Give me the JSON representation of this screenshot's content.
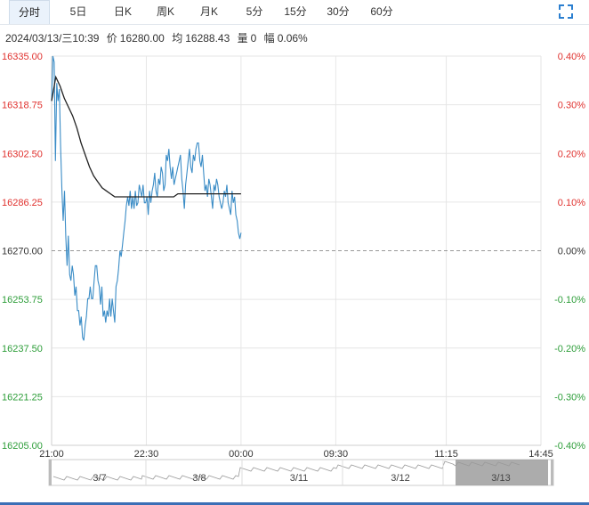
{
  "tabs": [
    {
      "label": "分时",
      "active": true
    },
    {
      "label": "5日",
      "active": false
    },
    {
      "label": "日K",
      "active": false
    },
    {
      "label": "周K",
      "active": false
    },
    {
      "label": "月K",
      "active": false
    },
    {
      "label": "5分",
      "active": false
    },
    {
      "label": "15分",
      "active": false
    },
    {
      "label": "30分",
      "active": false
    },
    {
      "label": "60分",
      "active": false
    }
  ],
  "fullscreen_icon": "expand-corners-icon",
  "info": {
    "datetime": "2024/03/13/三10:39",
    "price_label": "价",
    "price": "16280.00",
    "avg_label": "均",
    "avg": "16288.43",
    "volume_label": "量",
    "volume": "0",
    "change_label": "幅",
    "change": "0.06%"
  },
  "colors": {
    "price_line": "#3a8cc6",
    "avg_line": "#222222",
    "up": "#e0322f",
    "down": "#2e9e3a",
    "grid": "#e6e6e6",
    "baseline": "#999999"
  },
  "chart_data": {
    "type": "line",
    "title": "",
    "prev_close": 16270.0,
    "ylim": [
      16205.0,
      16335.0
    ],
    "y_ticks": [
      "16335.00",
      "16318.75",
      "16302.50",
      "16286.25",
      "16270.00",
      "16253.75",
      "16237.50",
      "16221.25",
      "16205.00"
    ],
    "pct_ticks": [
      "0.40%",
      "0.30%",
      "0.20%",
      "0.10%",
      "0.00%",
      "-0.10%",
      "-0.20%",
      "-0.30%",
      "-0.40%"
    ],
    "x_ticks": [
      {
        "label": "21:00",
        "index": 0
      },
      {
        "label": "22:30",
        "index": 90
      },
      {
        "label": "00:00",
        "index": 180
      },
      {
        "label": "09:30",
        "index": 270
      },
      {
        "label": "11:15",
        "index": 375
      },
      {
        "label": "14:45",
        "index": 465
      }
    ],
    "x_total": 465,
    "series": [
      {
        "role": "price",
        "values": [
          16320,
          16335,
          16333,
          16300,
          16326,
          16320,
          16324,
          16305,
          16290,
          16280,
          16290,
          16275,
          16265,
          16275,
          16262,
          16260,
          16265,
          16262,
          16255,
          16258,
          16250,
          16250,
          16245,
          16248,
          16241,
          16240,
          16245,
          16248,
          16254,
          16254,
          16258,
          16254,
          16254,
          16260,
          16265,
          16265,
          16260,
          16258,
          16252,
          16258,
          16248,
          16250,
          16246,
          16250,
          16248,
          16254,
          16248,
          16254,
          16250,
          16246,
          16258,
          16260,
          16264,
          16270,
          16268,
          16272,
          16276,
          16280,
          16285,
          16288,
          16285,
          16290,
          16284,
          16288,
          16284,
          16290,
          16285,
          16286,
          16292,
          16290,
          16288,
          16292,
          16286,
          16286,
          16288,
          16282,
          16290,
          16286,
          16290,
          16292,
          16296,
          16290,
          16288,
          16294,
          16292,
          16298,
          16296,
          16290,
          16292,
          16302,
          16300,
          16304,
          16298,
          16294,
          16298,
          16292,
          16294,
          16296,
          16298,
          16300,
          16302,
          16294,
          16290,
          16284,
          16292,
          16296,
          16300,
          16304,
          16298,
          16296,
          16302,
          16300,
          16304,
          16306,
          16306,
          16300,
          16298,
          16302,
          16296,
          16290,
          16292,
          16288,
          16294,
          16292,
          16288,
          16284,
          16292,
          16290,
          16294,
          16292,
          16288,
          16286,
          16284,
          16286,
          16290,
          16288,
          16292,
          16286,
          16284,
          16282,
          16290,
          16286,
          16288,
          16282,
          16280,
          16276,
          16274,
          16276
        ],
        "x_index_end": 180
      },
      {
        "role": "average",
        "values": [
          16320,
          16328,
          16325,
          16321,
          16318,
          16315,
          16311,
          16306,
          16302,
          16298,
          16295,
          16293,
          16291,
          16290,
          16289,
          16288,
          16288,
          16288,
          16288,
          16288,
          16288,
          16288,
          16288,
          16288,
          16288,
          16288,
          16288,
          16288,
          16288,
          16288,
          16289,
          16289,
          16289,
          16289,
          16289,
          16289,
          16289,
          16289,
          16289,
          16289,
          16289,
          16289,
          16289,
          16289,
          16289,
          16289
        ],
        "x_index_end": 180
      }
    ],
    "navigator": {
      "labels": [
        "3/7",
        "3/8",
        "3/11",
        "3/12",
        "3/13"
      ]
    }
  }
}
